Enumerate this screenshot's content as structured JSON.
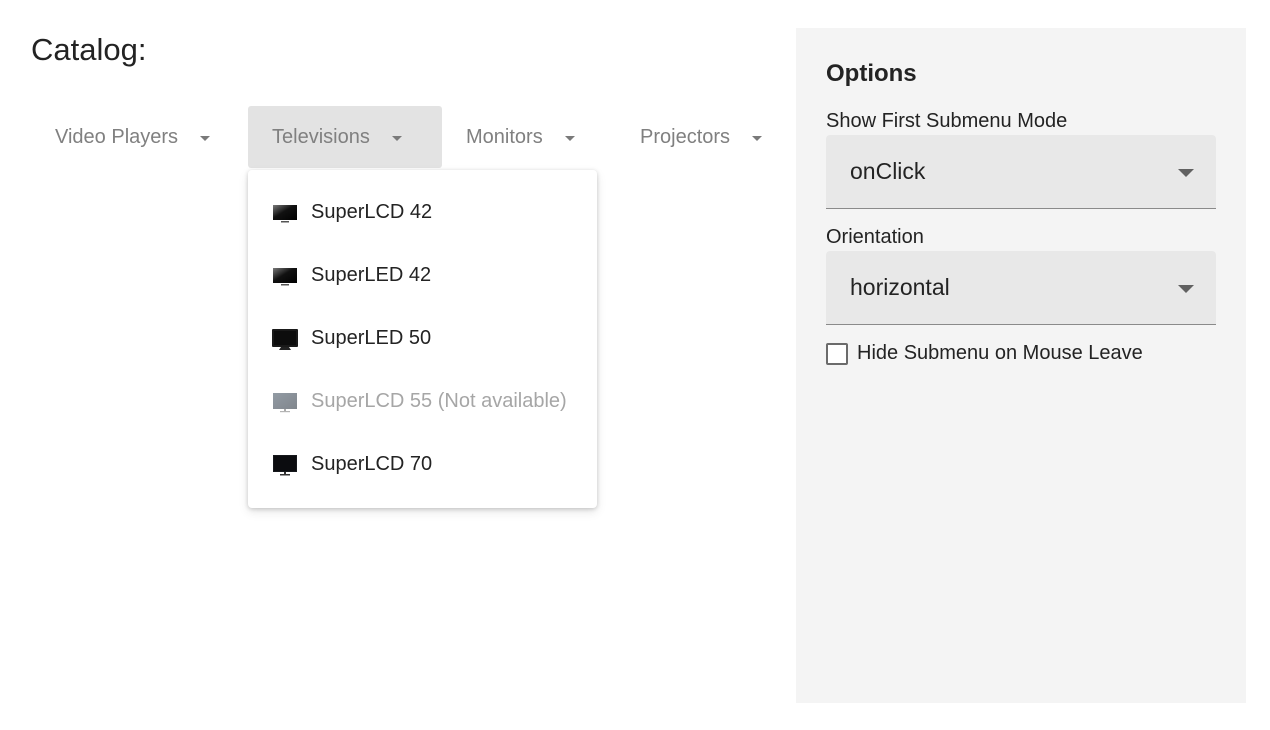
{
  "catalog": {
    "title": "Catalog:",
    "menu": [
      {
        "label": "Video Players",
        "active": false
      },
      {
        "label": "Televisions",
        "active": true
      },
      {
        "label": "Monitors",
        "active": false
      },
      {
        "label": "Projectors",
        "active": false
      }
    ],
    "submenu": [
      {
        "label": "SuperLCD 42",
        "icon": "tv-icon",
        "disabled": false
      },
      {
        "label": "SuperLED 42",
        "icon": "tv-icon",
        "disabled": false
      },
      {
        "label": "SuperLED 50",
        "icon": "tv-icon",
        "disabled": false
      },
      {
        "label": "SuperLCD 55 (Not available)",
        "icon": "tv-icon",
        "disabled": true
      },
      {
        "label": "SuperLCD 70",
        "icon": "tv-icon",
        "disabled": false
      }
    ]
  },
  "options": {
    "title": "Options",
    "show_first_submenu_mode": {
      "label": "Show First Submenu Mode",
      "value": "onClick"
    },
    "orientation": {
      "label": "Orientation",
      "value": "horizontal"
    },
    "hide_submenu": {
      "label": "Hide Submenu on Mouse Leave",
      "checked": false
    }
  },
  "colors": {
    "active_menu_bg": "#e3e3e3",
    "options_panel_bg": "#f4f4f4",
    "select_bg": "#e8e8e8",
    "muted_text": "#808080",
    "disabled_text": "#a6a6a6"
  }
}
